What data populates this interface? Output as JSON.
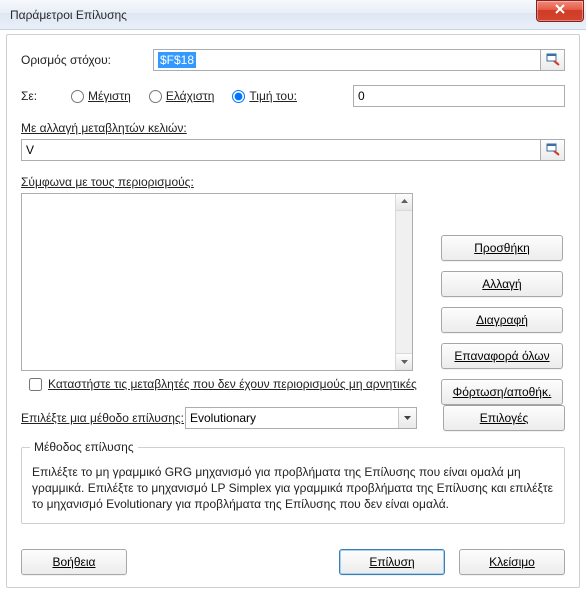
{
  "window": {
    "title": "Παράμετροι Επίλυσης"
  },
  "objective": {
    "label": "Ορισμός στόχου:",
    "value": "$F$18"
  },
  "to": {
    "label": "Σε:",
    "max": "Μέγιστη",
    "min": "Ελάχιστη",
    "valueOf": "Τιμή του:",
    "valueOfValue": "0",
    "selected": "valueOf"
  },
  "changing": {
    "label": "Με αλλαγή μεταβλητών κελιών:",
    "value": "V"
  },
  "constraints": {
    "label": "Σύμφωνα με τους περιορισμούς:",
    "buttons": {
      "add": "Προσθήκη",
      "change": "Αλλαγή",
      "delete": "Διαγραφή",
      "resetAll": "Επαναφορά όλων",
      "loadSave": "Φόρτωση/αποθήκ."
    }
  },
  "nonNegative": "Καταστήστε τις μεταβλητές που δεν έχουν περιορισμούς μη αρνητικές",
  "method": {
    "label": "Επιλέξτε μια μέθοδο επίλυσης:",
    "selected": "Evolutionary",
    "optionsButton": "Επιλογές"
  },
  "description": {
    "legend": "Μέθοδος επίλυσης",
    "text": "Επιλέξτε το μη γραμμικό GRG μηχανισμό για προβλήματα της Επίλυσης που είναι ομαλά μη γραμμικά. Επιλέξτε το μηχανισμό LP Simplex για γραμμικά προβλήματα της Επίλυσης και επιλέξτε το μηχανισμό Evolutionary για προβλήματα της Επίλυσης που δεν είναι ομαλά."
  },
  "bottom": {
    "help": "Βοήθεια",
    "solve": "Επίλυση",
    "close": "Κλείσιμο"
  }
}
